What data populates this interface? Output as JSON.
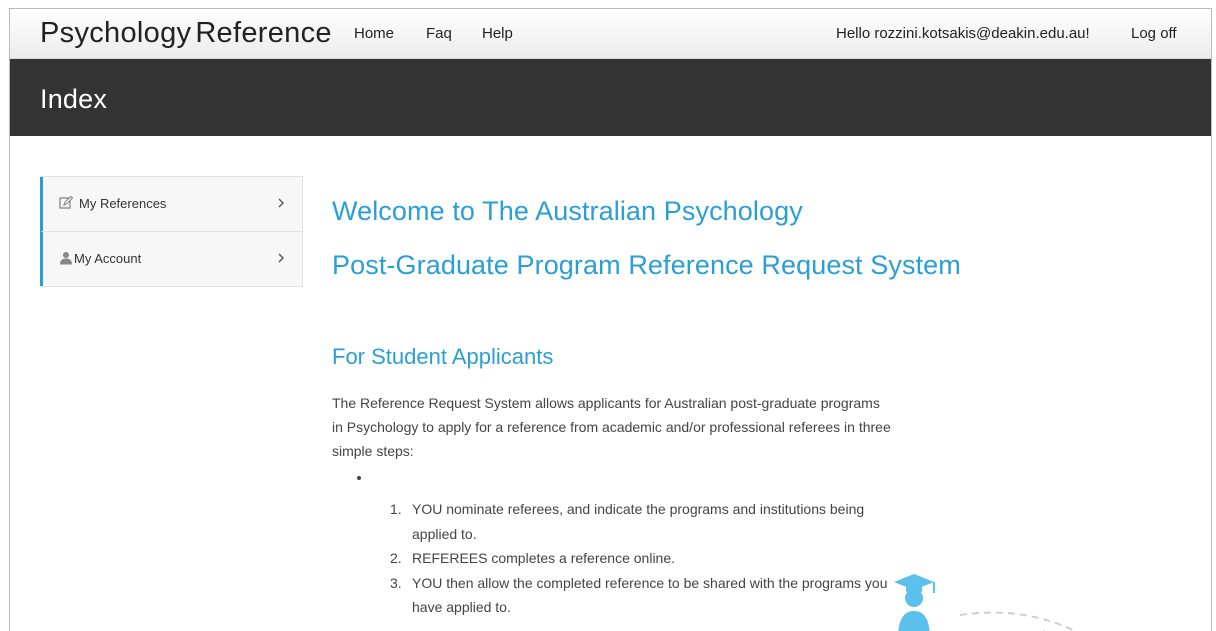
{
  "navbar": {
    "brand_part1": "Psychology",
    "brand_part2": "Reference",
    "links": {
      "home": "Home",
      "faq": "Faq",
      "help": "Help"
    },
    "greeting": "Hello rozzini.kotsakis@deakin.edu.au!",
    "logoff": "Log off"
  },
  "header": {
    "title": "Index"
  },
  "sidebar": {
    "items": [
      {
        "label": "My References",
        "icon": "edit-icon"
      },
      {
        "label": "My Account",
        "icon": "user-icon"
      }
    ]
  },
  "main": {
    "welcome_line1": "Welcome to The Australian Psychology",
    "welcome_line2": "Post-Graduate Program Reference Request System",
    "section_heading": "For Student Applicants",
    "intro": "The Reference Request System allows applicants for Australian post-graduate programs in Psychology to apply for a reference from academic and/or professional referees in three simple steps:",
    "steps": [
      {
        "num": "1.",
        "text": "YOU nominate referees, and indicate the programs and institutions being applied to."
      },
      {
        "num": "2.",
        "text": "REFEREES completes a reference online."
      },
      {
        "num": "3.",
        "text": "YOU then allow the completed reference to be shared with the programs you have applied to."
      }
    ]
  },
  "colors": {
    "accent": "#2a9fd6",
    "header_band": "#333333",
    "icon_blue": "#5bc0eb"
  }
}
